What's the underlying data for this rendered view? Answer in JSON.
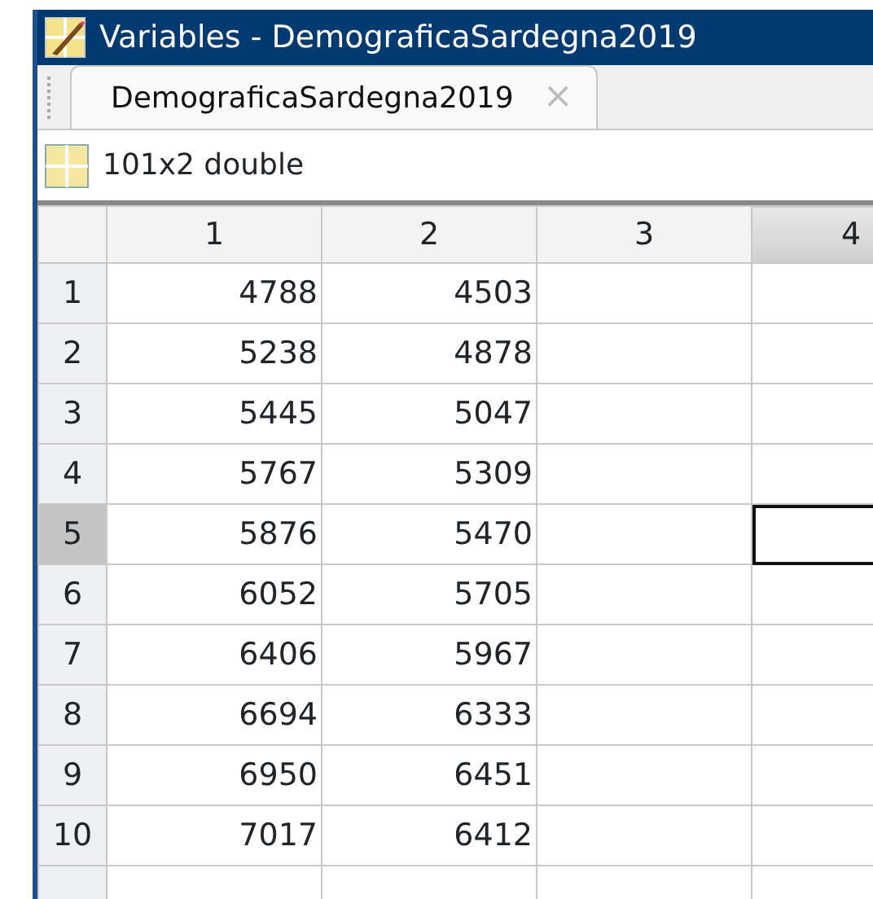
{
  "window": {
    "title": "Variables - DemograficaSardegna2019"
  },
  "tabs": [
    {
      "label": "DemograficaSardegna2019",
      "selected": true,
      "close": "×"
    }
  ],
  "info": {
    "label": "101x2 double"
  },
  "table": {
    "columns": [
      {
        "label": "1",
        "selected": false
      },
      {
        "label": "2",
        "selected": false
      },
      {
        "label": "3",
        "selected": false
      },
      {
        "label": "4",
        "selected": true
      }
    ],
    "rows": [
      {
        "label": "1",
        "selected": false,
        "cells": [
          "4788",
          "4503"
        ]
      },
      {
        "label": "2",
        "selected": false,
        "cells": [
          "5238",
          "4878"
        ]
      },
      {
        "label": "3",
        "selected": false,
        "cells": [
          "5445",
          "5047"
        ]
      },
      {
        "label": "4",
        "selected": false,
        "cells": [
          "5767",
          "5309"
        ]
      },
      {
        "label": "5",
        "selected": true,
        "cells": [
          "5876",
          "5470"
        ]
      },
      {
        "label": "6",
        "selected": false,
        "cells": [
          "6052",
          "5705"
        ]
      },
      {
        "label": "7",
        "selected": false,
        "cells": [
          "6406",
          "5967"
        ]
      },
      {
        "label": "8",
        "selected": false,
        "cells": [
          "6694",
          "6333"
        ]
      },
      {
        "label": "9",
        "selected": false,
        "cells": [
          "6950",
          "6451"
        ]
      },
      {
        "label": "10",
        "selected": false,
        "cells": [
          "7017",
          "6412"
        ]
      }
    ]
  }
}
